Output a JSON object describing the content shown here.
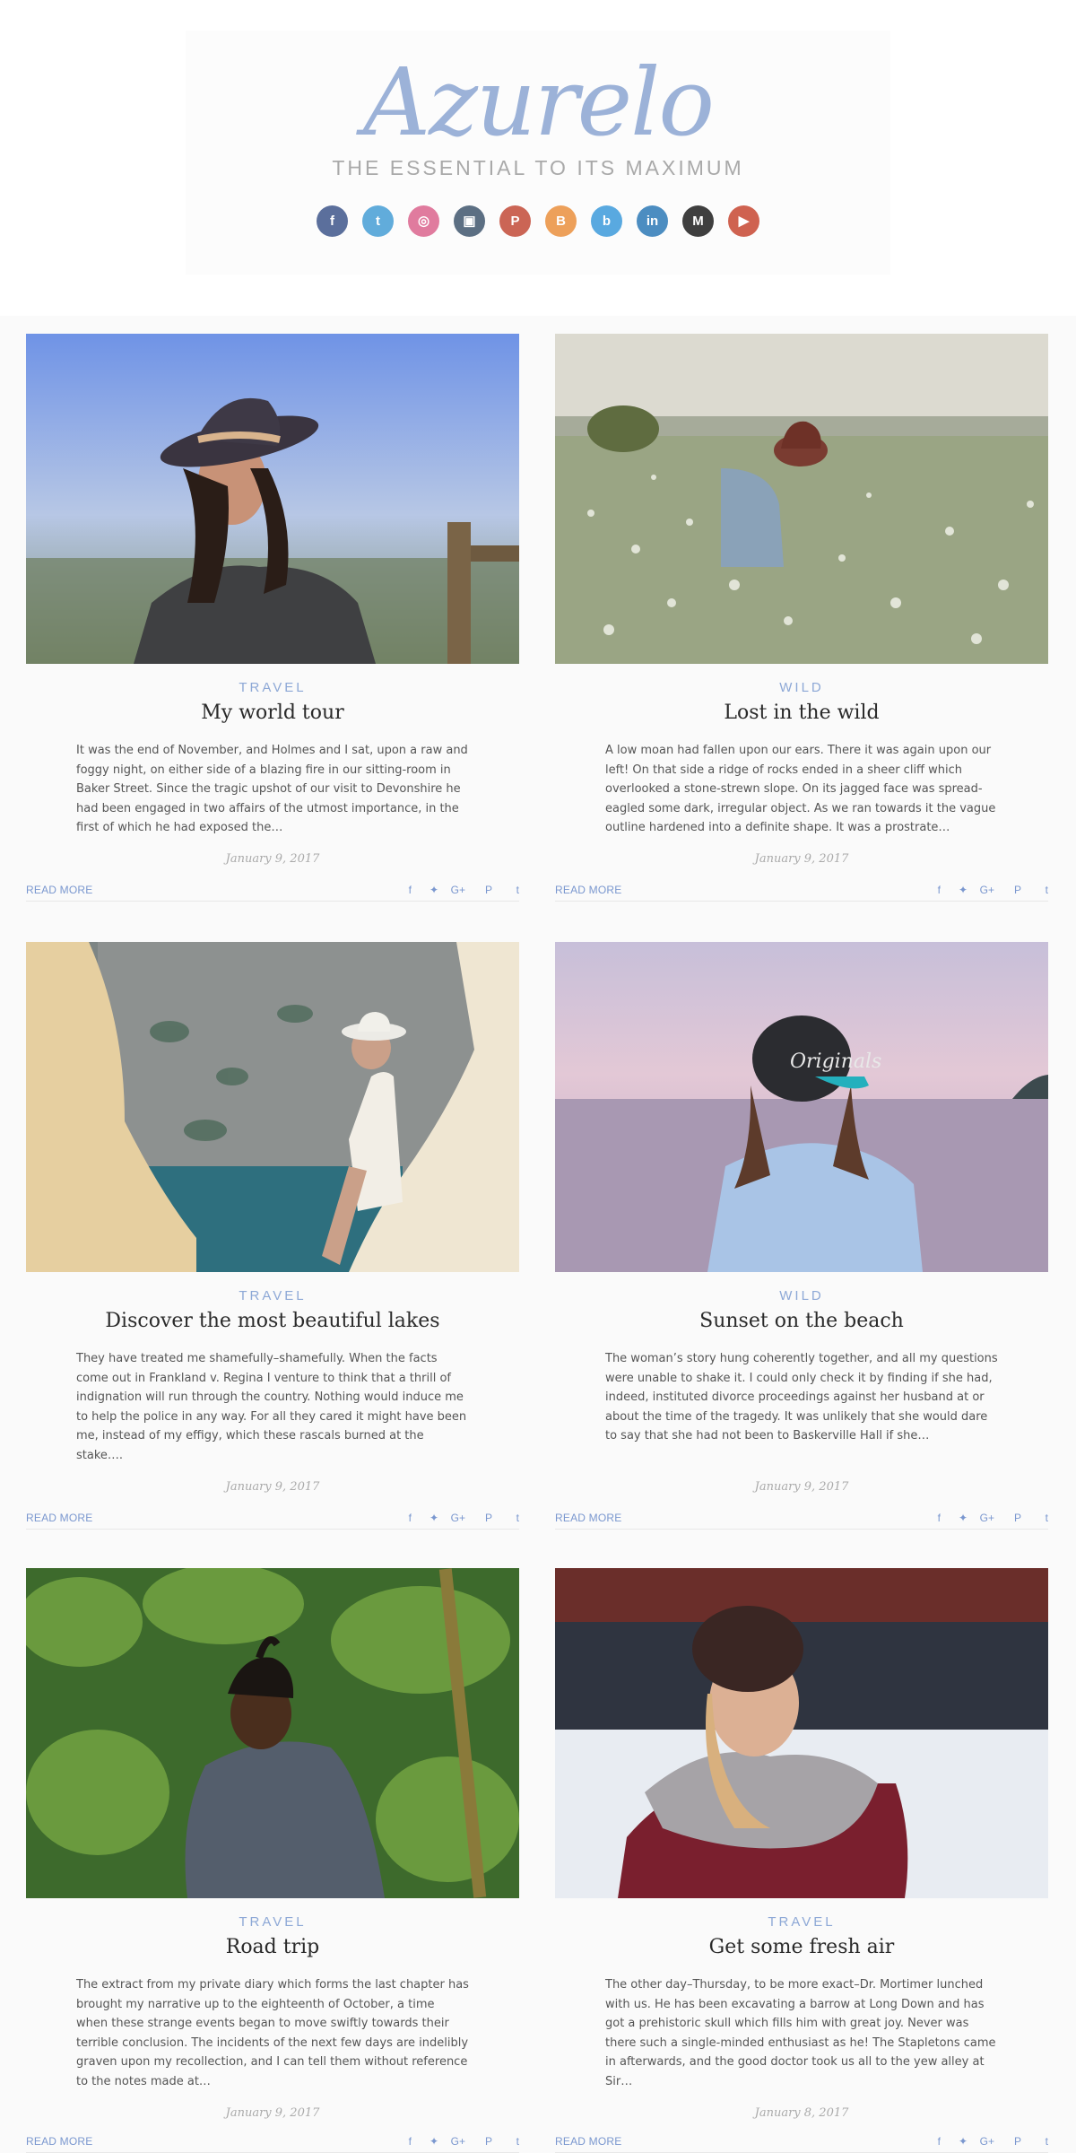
{
  "header": {
    "logo": "Azurelo",
    "tagline": "THE ESSENTIAL TO ITS MAXIMUM",
    "socials": [
      {
        "icon": "facebook-icon",
        "glyph": "f",
        "color": "#5b6f9c"
      },
      {
        "icon": "twitter-icon",
        "glyph": "t",
        "color": "#61acdb"
      },
      {
        "icon": "dribbble-icon",
        "glyph": "◎",
        "color": "#e07b9e"
      },
      {
        "icon": "instagram-icon",
        "glyph": "▣",
        "color": "#5c6f83"
      },
      {
        "icon": "pinterest-icon",
        "glyph": "P",
        "color": "#cb6555"
      },
      {
        "icon": "blogger-icon",
        "glyph": "B",
        "color": "#eda05a"
      },
      {
        "icon": "behance-icon",
        "glyph": "b",
        "color": "#59a9e0"
      },
      {
        "icon": "linkedin-icon",
        "glyph": "in",
        "color": "#4c8dc1"
      },
      {
        "icon": "medium-icon",
        "glyph": "M",
        "color": "#3f3f3f"
      },
      {
        "icon": "youtube-icon",
        "glyph": "▶",
        "color": "#cf6250"
      }
    ]
  },
  "posts": [
    {
      "category": "TRAVEL",
      "title": "My world tour",
      "excerpt": "It was the end of November, and Holmes and I sat, upon a raw and foggy night, on either side of a blazing fire in our sitting-room in Baker Street. Since the tragic upshot of our visit to Devonshire he had been engaged in two affairs of the utmost importance, in the first of which he had exposed the…",
      "date": "January 9, 2017",
      "read_more": "READ MORE"
    },
    {
      "category": "WILD",
      "title": "Lost in the wild",
      "excerpt": "A low moan had fallen upon our ears. There it was again upon our left! On that side a ridge of rocks ended in a sheer cliff which overlooked a stone-strewn slope. On its jagged face was spread-eagled some dark, irregular object. As we ran towards it the vague outline hardened into a definite shape. It was a prostrate…",
      "date": "January 9, 2017",
      "read_more": "READ MORE"
    },
    {
      "category": "TRAVEL",
      "title": "Discover the most beautiful lakes",
      "excerpt": "They have treated me shamefully–shamefully. When the facts come out in Frankland v. Regina I venture to think that a thrill of indignation will run through the country. Nothing would induce me to help the police in any way. For all they cared it might have been me, instead of my effigy, which these rascals burned at the stake….",
      "date": "January 9, 2017",
      "read_more": "READ MORE"
    },
    {
      "category": "WILD",
      "title": "Sunset on the beach",
      "excerpt": "The woman’s story hung coherently together, and all my questions were unable to shake it. I could only check it by finding if she had, indeed, instituted divorce proceedings against her husband at or about the time of the tragedy. It was unlikely that she would dare to say that she had not been to Baskerville Hall if she…",
      "date": "January 9, 2017",
      "read_more": "READ MORE"
    },
    {
      "category": "TRAVEL",
      "title": "Road trip",
      "excerpt": "The extract from my private diary which forms the last chapter has brought my narrative up to the eighteenth of October, a time when these strange events began to move swiftly towards their terrible conclusion. The incidents of the next few days are indelibly graven upon my recollection, and I can tell them without reference to the notes made at…",
      "date": "January 9, 2017",
      "read_more": "READ MORE"
    },
    {
      "category": "TRAVEL",
      "title": "Get some fresh air",
      "excerpt": "The other day–Thursday, to be more exact–Dr. Mortimer lunched with us. He has been excavating a barrow at Long Down and has got a prehistoric skull which fills him with great joy. Never was there such a single-minded enthusiast as he! The Stapletons came in afterwards, and the good doctor took us all to the yew alley at Sir…",
      "date": "January 8, 2017",
      "read_more": "READ MORE"
    }
  ],
  "share_icons": [
    {
      "icon": "facebook-icon",
      "glyph": "f"
    },
    {
      "icon": "twitter-icon",
      "glyph": "✦"
    },
    {
      "icon": "google-plus-icon",
      "glyph": "G+"
    },
    {
      "icon": "pinterest-icon",
      "glyph": "P"
    },
    {
      "icon": "tumblr-icon",
      "glyph": "t"
    }
  ]
}
